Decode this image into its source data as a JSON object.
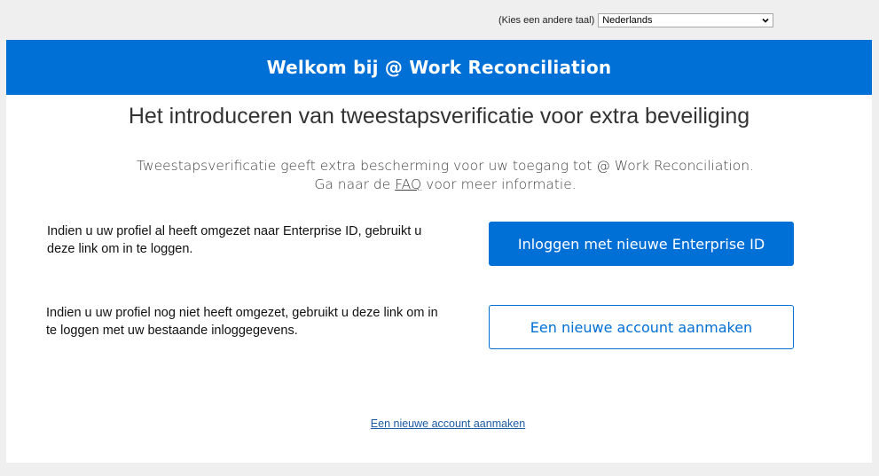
{
  "language": {
    "label": "(Kies een andere taal)",
    "selected": "Nederlands"
  },
  "banner": {
    "title": "Welkom bij @ Work Reconciliation"
  },
  "main": {
    "heading": "Het introduceren van tweestapsverificatie voor extra beveiliging",
    "intro_line1": "Tweestapsverificatie geeft extra bescherming voor uw toegang tot @ Work Reconciliation.",
    "intro_line2_prefix": "Ga naar de",
    "faq_link": "FAQ",
    "intro_line2_suffix": "voor meer informatie."
  },
  "options": [
    {
      "description": "Indien u uw profiel al heeft omgezet naar Enterprise ID, gebruikt u deze link om in te loggen.",
      "button": "Inloggen met nieuwe Enterprise ID"
    },
    {
      "description": "Indien u uw profiel nog niet heeft omgezet,  gebruikt u deze link om in te loggen met uw bestaande inloggegevens.",
      "button": "Een nieuwe account aanmaken"
    }
  ],
  "footer_link": "Een nieuwe account aanmaken",
  "colors": {
    "brand_blue": "#006fd6",
    "page_background": "#efefef"
  },
  "icons": {
    "language_dropdown": "chevron-down-icon"
  }
}
